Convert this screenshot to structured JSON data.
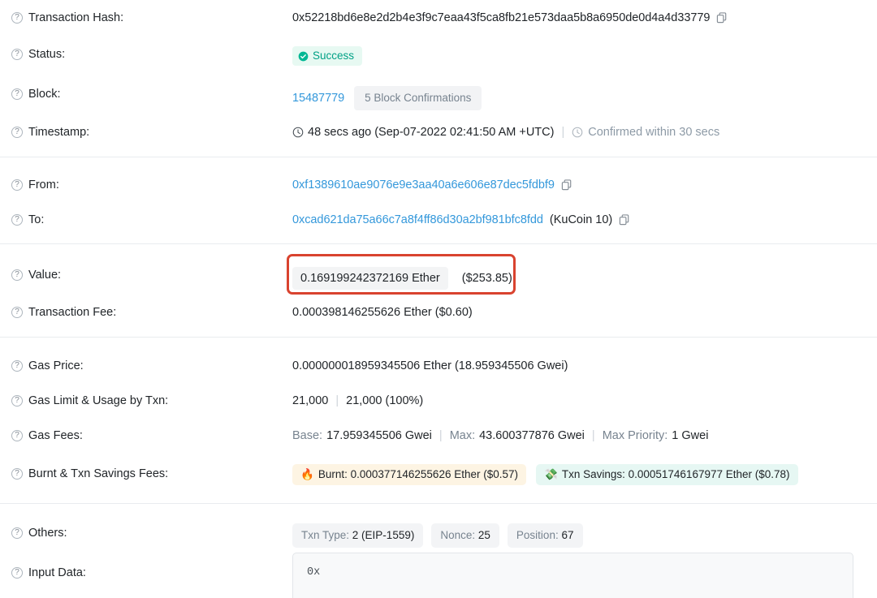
{
  "rows": {
    "transaction_hash": {
      "label": "Transaction Hash:",
      "value": "0x52218bd6e8e2d2b4e3f9c7eaa43f5ca8fb21e573daa5b8a6950de0d4a4d33779"
    },
    "status": {
      "label": "Status:",
      "value": "Success"
    },
    "block": {
      "label": "Block:",
      "number": "15487779",
      "confirmations": "5 Block Confirmations"
    },
    "timestamp": {
      "label": "Timestamp:",
      "ago": "48 secs ago (Sep-07-2022 02:41:50 AM +UTC)",
      "separator": "|",
      "confirmed": "Confirmed within 30 secs"
    },
    "from": {
      "label": "From:",
      "address": "0xf1389610ae9076e9e3aa40a6e606e87dec5fdbf9"
    },
    "to": {
      "label": "To:",
      "address": "0xcad621da75a66c7a8f4ff86d30a2bf981bfc8fdd",
      "tag": "(KuCoin 10)"
    },
    "value": {
      "label": "Value:",
      "ether": "0.169199242372169 Ether",
      "usd": "($253.85)"
    },
    "transaction_fee": {
      "label": "Transaction Fee:",
      "value": "0.000398146255626 Ether ($0.60)"
    },
    "gas_price": {
      "label": "Gas Price:",
      "value": "0.000000018959345506 Ether (18.959345506 Gwei)"
    },
    "gas_limit_usage": {
      "label": "Gas Limit & Usage by Txn:",
      "limit": "21,000",
      "separator": "|",
      "usage": "21,000 (100%)"
    },
    "gas_fees": {
      "label": "Gas Fees:",
      "base_label": "Base:",
      "base_value": "17.959345506 Gwei",
      "max_label": "Max:",
      "max_value": "43.600377876 Gwei",
      "max_priority_label": "Max Priority:",
      "max_priority_value": "1 Gwei",
      "separator": "|"
    },
    "burnt_savings": {
      "label": "Burnt & Txn Savings Fees:",
      "burnt_emoji": "🔥",
      "burnt": "Burnt: 0.000377146255626 Ether ($0.57)",
      "savings_emoji": "💸",
      "savings": "Txn Savings: 0.00051746167977 Ether ($0.78)"
    },
    "others": {
      "label": "Others:",
      "txn_type_label": "Txn Type:",
      "txn_type_value": "2 (EIP-1559)",
      "nonce_label": "Nonce:",
      "nonce_value": "25",
      "position_label": "Position:",
      "position_value": "67"
    },
    "input_data": {
      "label": "Input Data:",
      "value": "0x"
    }
  },
  "icons": {
    "help": "?",
    "copy": "copy-icon",
    "clock": "clock-icon",
    "check": "check-circle-icon"
  },
  "colors": {
    "link": "#3498db",
    "success": "#00a186",
    "success_bg": "#e7f9f2",
    "highlight": "#d9432f",
    "badge_gray_bg": "#f2f3f5",
    "burnt_bg": "#fdf4e3",
    "savings_bg": "#e6f7f3"
  }
}
